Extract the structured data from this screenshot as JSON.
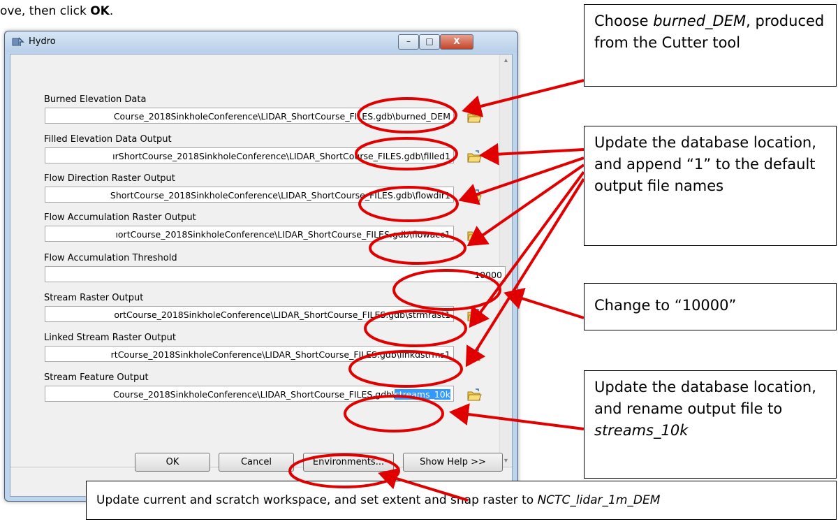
{
  "intro": {
    "text_before": "ove, then click ",
    "ok_word": "OK",
    "text_after": "."
  },
  "window": {
    "title": "Hydro",
    "controls": {
      "minimize": "–",
      "maximize": "□",
      "close": "X"
    },
    "title_icon": "tool-icon",
    "browse_icon": "folder-open-icon"
  },
  "fields": {
    "burned": {
      "label": "Burned Elevation Data",
      "value": "Course_2018SinkholeConference\\LIDAR_ShortCourse_FILES.gdb\\burned_DEM"
    },
    "filled": {
      "label": "Filled Elevation Data Output",
      "value": "ırShortCourse_2018SinkholeConference\\LIDAR_ShortCourse_FILES.gdb\\filled1"
    },
    "flowdir": {
      "label": "Flow Direction Raster Output",
      "value": "ShortCourse_2018SinkholeConference\\LIDAR_ShortCourse_FILES.gdb\\flowdir1"
    },
    "flowacc": {
      "label": "Flow Accumulation Raster Output",
      "value": "ıortCourse_2018SinkholeConference\\LIDAR_ShortCourse_FILES.gdb\\flowacc1"
    },
    "threshold": {
      "label": "Flow Accumulation Threshold",
      "value": "10000"
    },
    "strmrast": {
      "label": "Stream Raster Output",
      "value": "ortCourse_2018SinkholeConference\\LIDAR_ShortCourse_FILES.gdb\\strmrast1"
    },
    "linked": {
      "label": "Linked Stream Raster Output",
      "value": "rtCourse_2018SinkholeConference\\LIDAR_ShortCourse_FILES.gdb\\linkdstrms1"
    },
    "feature": {
      "label": "Stream Feature Output",
      "value_prefix": "Course_2018SinkholeConference\\LIDAR_ShortCourse_FILES.gdb\\",
      "value_selected": "streams_10k"
    }
  },
  "buttons": {
    "ok": "OK",
    "cancel": "Cancel",
    "environments": "Environments...",
    "show_help": "Show Help >>"
  },
  "callouts": {
    "c1": {
      "before": "Choose ",
      "italic": "burned_DEM",
      "after": ", produced from the Cutter tool"
    },
    "c2": {
      "text": "Update the database location, and append “1” to the default output file names"
    },
    "c3": {
      "text": "Change to “10000”"
    },
    "c4": {
      "text": "Update the database location, and rename output file to ",
      "italic": "streams_10k"
    },
    "bottom": {
      "text": "Update current and scratch workspace, and set extent and snap raster to ",
      "italic": "NCTC_lidar_1m_DEM"
    }
  },
  "colors": {
    "annotation": "#e00000",
    "selection": "#3399ff",
    "title_bar": "#bcd4ec",
    "dialog_bg": "#f0f0f0"
  }
}
